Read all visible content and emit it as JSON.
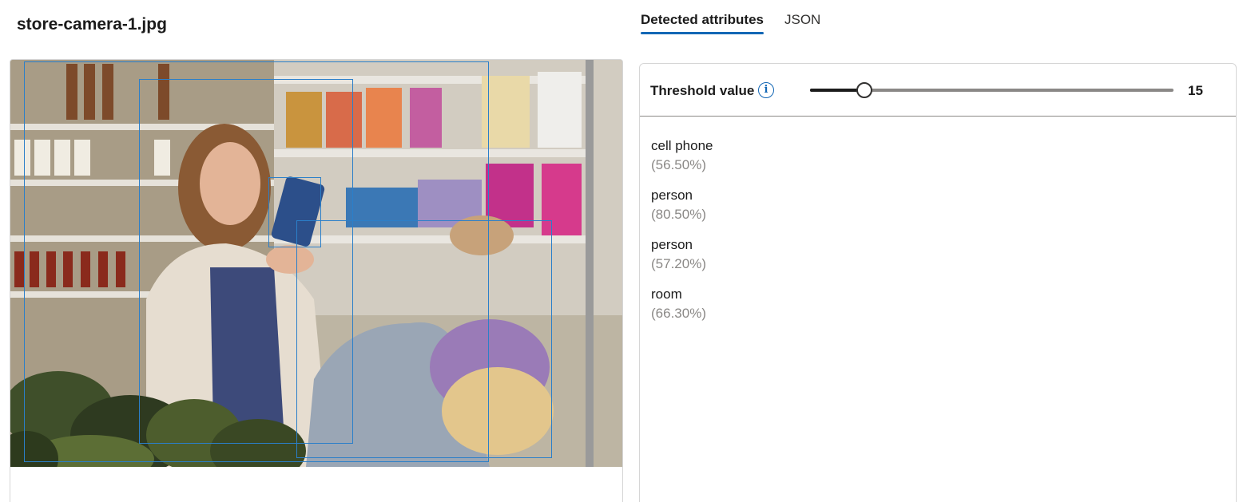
{
  "file": {
    "name": "store-camera-1.jpg"
  },
  "tabs": [
    {
      "label": "Detected attributes",
      "active": true
    },
    {
      "label": "JSON",
      "active": false
    }
  ],
  "threshold": {
    "label": "Threshold value",
    "value": "15",
    "fraction": 0.15
  },
  "attributes": [
    {
      "name": "cell phone",
      "confidence": "(56.50%)"
    },
    {
      "name": "person",
      "confidence": "(80.50%)"
    },
    {
      "name": "person",
      "confidence": "(57.20%)"
    },
    {
      "name": "room",
      "confidence": "(66.30%)"
    }
  ],
  "colors": {
    "accent": "#1367b5",
    "bbox": "#2b7fc9",
    "muted": "#8a8886"
  },
  "icons": {
    "info": "info-icon"
  }
}
